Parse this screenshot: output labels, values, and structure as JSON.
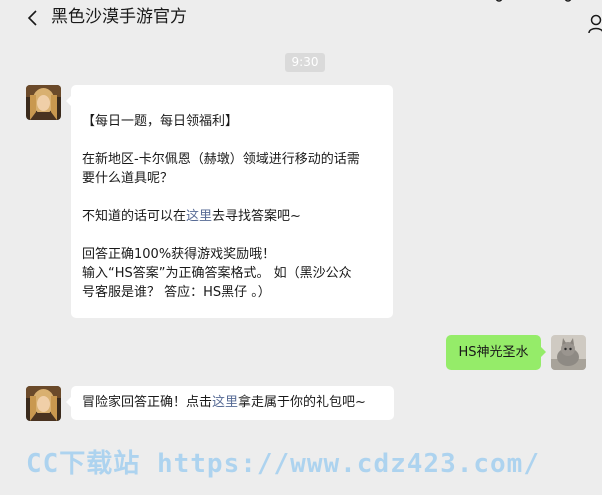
{
  "header": {
    "back_icon": "chevron-left-icon",
    "title": "黑色沙漠手游官方",
    "right_icon": "user-icon"
  },
  "timestamp": "9:30",
  "messages": [
    {
      "sender": "official",
      "lines": [
        "【每日一题，每日领福利】",
        "",
        "在新地区-卡尔佩恩（赫墩）领域进行移动的话需",
        "要什么道具呢？",
        "",
        {
          "before": "不知道的话可以在",
          "link": "这里",
          "after": "去寻找答案吧~"
        },
        "",
        "回答正确100%获得游戏奖励哦！",
        "输入“HS答案”为正确答案格式。 如（黑沙公众",
        "号客服是谁？ 答应：HS黑仔 。）"
      ]
    },
    {
      "sender": "user",
      "text": "HS神光圣水"
    },
    {
      "sender": "official",
      "before": "冒险家回答正确！点击",
      "link": "这里",
      "after": "拿走属于你的礼包吧~"
    }
  ],
  "watermark": "CC下载站 https://www.cdz423.com/",
  "colors": {
    "background": "#ededed",
    "bubble_white": "#ffffff",
    "bubble_green": "#95ec69",
    "link": "#576b95"
  }
}
